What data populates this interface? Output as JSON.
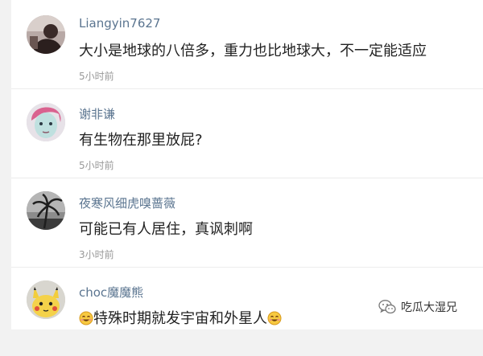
{
  "comments": [
    {
      "avatar_icon": "avatar-silhouette-dark-icon",
      "username": "Liangyin7627",
      "content": "大小是地球的八倍多，重力也比地球大，不一定能适应",
      "time": "5小时前"
    },
    {
      "avatar_icon": "avatar-cartoon-face-icon",
      "username": "谢非谦",
      "content": "有生物在那里放屁?",
      "time": "5小时前"
    },
    {
      "avatar_icon": "avatar-palm-tree-icon",
      "username": "夜寒风细虎嗅蔷薇",
      "content": "可能已有人居住，真讽刺啊",
      "time": "3小时前"
    },
    {
      "avatar_icon": "avatar-pikachu-icon",
      "username": "choc魔魔熊",
      "content_prefix_icon": "smiling-emoji-icon",
      "content": "特殊时期就发宇宙和外星人",
      "content_suffix_icon": "smiling-emoji-icon"
    }
  ],
  "watermark": {
    "icon": "wechat-icon",
    "text": "吃瓜大湿兄"
  },
  "colors": {
    "username": "#5b7590",
    "content": "#222222",
    "time": "#999999",
    "background": "#f2f2f2"
  }
}
